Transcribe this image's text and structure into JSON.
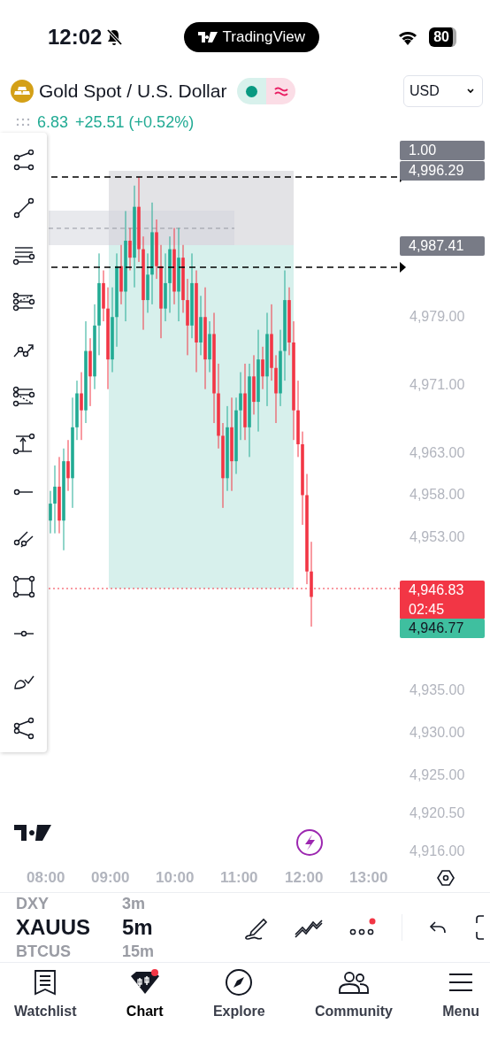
{
  "status_bar": {
    "time": "12:02",
    "app_pill": "TradingView",
    "battery": "80"
  },
  "header": {
    "title": "Gold Spot / U.S. Dollar",
    "market_open": true,
    "currency": "USD",
    "price": "6.83",
    "change": "+25.51 (+0.52%)"
  },
  "chart": {
    "price_ticks": [
      "4,979.00",
      "4,971.00",
      "4,963.00",
      "4,958.00",
      "4,953.00",
      "4,935.00",
      "4,930.00",
      "4,925.00",
      "4,920.50",
      "4,916.00"
    ],
    "price_tags": [
      {
        "kind": "quantity",
        "text": "1.00"
      },
      {
        "kind": "stop",
        "text": "4,996.29"
      },
      {
        "kind": "entry",
        "text": "4,987.41"
      },
      {
        "kind": "last",
        "text": "4,946.83",
        "countdown": "02:45"
      },
      {
        "kind": "bid",
        "text": "4,946.77"
      }
    ],
    "time_ticks": [
      "08:00",
      "09:00",
      "10:00",
      "11:00",
      "12:00",
      "13:00"
    ]
  },
  "symbol_bar": {
    "symbols": [
      {
        "text": "DXY",
        "selected": false
      },
      {
        "text": "XAUUS",
        "selected": true
      },
      {
        "text": "BTCUS",
        "selected": false
      }
    ],
    "intervals": [
      {
        "text": "3m",
        "selected": false
      },
      {
        "text": "5m",
        "selected": true
      },
      {
        "text": "15m",
        "selected": false
      }
    ]
  },
  "nav": [
    {
      "label": "Watchlist",
      "kind": "watchlist",
      "selected": false
    },
    {
      "label": "Chart",
      "kind": "chart",
      "selected": true
    },
    {
      "label": "Explore",
      "kind": "explore",
      "selected": false
    },
    {
      "label": "Community",
      "kind": "community",
      "selected": false
    },
    {
      "label": "Menu",
      "kind": "menu",
      "selected": false
    }
  ]
}
